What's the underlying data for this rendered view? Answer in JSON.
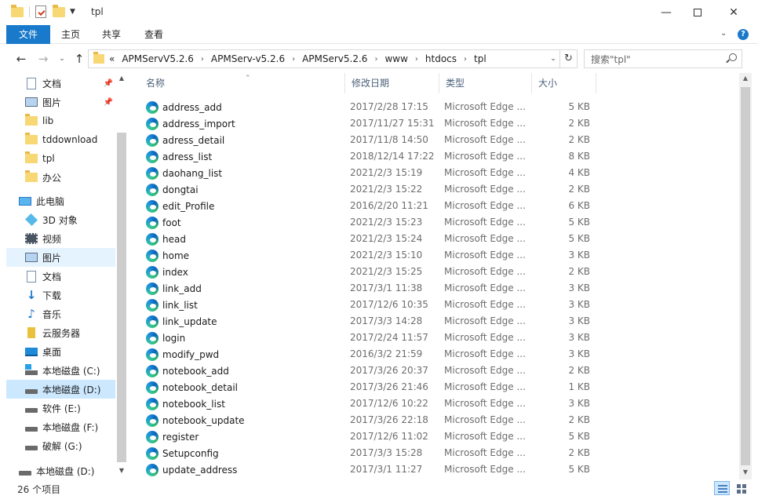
{
  "window": {
    "title": "tpl"
  },
  "ribbon": {
    "tabs": [
      "文件",
      "主页",
      "共享",
      "查看"
    ]
  },
  "address": {
    "overflow": "«",
    "crumbs": [
      "APMServV5.2.6",
      "APMServ-v5.2.6",
      "APMServ5.2.6",
      "www",
      "htdocs",
      "tpl"
    ],
    "separator": "›",
    "search_placeholder": "搜索\"tpl\""
  },
  "nav": {
    "quick": [
      {
        "label": "文档",
        "icon": "document-icon",
        "pinned": true
      },
      {
        "label": "图片",
        "icon": "picture-icon",
        "pinned": true
      },
      {
        "label": "lib",
        "icon": "folder-icon"
      },
      {
        "label": "tddownload",
        "icon": "folder-icon"
      },
      {
        "label": "tpl",
        "icon": "folder-icon"
      },
      {
        "label": "办公",
        "icon": "folder-icon"
      }
    ],
    "pc_label": "此电脑",
    "pc_items": [
      {
        "label": "3D 对象",
        "icon": "3d-objects-icon"
      },
      {
        "label": "视频",
        "icon": "video-icon"
      },
      {
        "label": "图片",
        "icon": "picture-icon",
        "hover": true
      },
      {
        "label": "文档",
        "icon": "document-icon"
      },
      {
        "label": "下载",
        "icon": "download-icon"
      },
      {
        "label": "音乐",
        "icon": "music-icon"
      },
      {
        "label": "云服务器",
        "icon": "cloud-server-icon"
      },
      {
        "label": "桌面",
        "icon": "desktop-icon"
      },
      {
        "label": "本地磁盘 (C:)",
        "icon": "windows-drive-icon"
      },
      {
        "label": "本地磁盘 (D:)",
        "icon": "drive-icon",
        "selected": true
      },
      {
        "label": "软件 (E:)",
        "icon": "drive-icon"
      },
      {
        "label": "本地磁盘 (F:)",
        "icon": "drive-icon"
      },
      {
        "label": "破解 (G:)",
        "icon": "drive-icon"
      }
    ],
    "bottom_label": "本地磁盘 (D:)"
  },
  "columns": {
    "name": "名称",
    "date": "修改日期",
    "type": "类型",
    "size": "大小"
  },
  "files": [
    {
      "name": "address_add",
      "date": "2017/2/28 17:15",
      "type": "Microsoft Edge ...",
      "size": "5 KB"
    },
    {
      "name": "address_import",
      "date": "2017/11/27 15:31",
      "type": "Microsoft Edge ...",
      "size": "2 KB"
    },
    {
      "name": "adress_detail",
      "date": "2017/11/8 14:50",
      "type": "Microsoft Edge ...",
      "size": "2 KB"
    },
    {
      "name": "adress_list",
      "date": "2018/12/14 17:22",
      "type": "Microsoft Edge ...",
      "size": "8 KB"
    },
    {
      "name": "daohang_list",
      "date": "2021/2/3 15:19",
      "type": "Microsoft Edge ...",
      "size": "4 KB"
    },
    {
      "name": "dongtai",
      "date": "2021/2/3 15:22",
      "type": "Microsoft Edge ...",
      "size": "2 KB"
    },
    {
      "name": "edit_Profile",
      "date": "2016/2/20 11:21",
      "type": "Microsoft Edge ...",
      "size": "6 KB"
    },
    {
      "name": "foot",
      "date": "2021/2/3 15:23",
      "type": "Microsoft Edge ...",
      "size": "5 KB"
    },
    {
      "name": "head",
      "date": "2021/2/3 15:24",
      "type": "Microsoft Edge ...",
      "size": "5 KB"
    },
    {
      "name": "home",
      "date": "2021/2/3 15:10",
      "type": "Microsoft Edge ...",
      "size": "3 KB"
    },
    {
      "name": "index",
      "date": "2021/2/3 15:25",
      "type": "Microsoft Edge ...",
      "size": "2 KB"
    },
    {
      "name": "link_add",
      "date": "2017/3/1 11:38",
      "type": "Microsoft Edge ...",
      "size": "3 KB"
    },
    {
      "name": "link_list",
      "date": "2017/12/6 10:35",
      "type": "Microsoft Edge ...",
      "size": "3 KB"
    },
    {
      "name": "link_update",
      "date": "2017/3/3 14:28",
      "type": "Microsoft Edge ...",
      "size": "3 KB"
    },
    {
      "name": "login",
      "date": "2017/2/24 11:57",
      "type": "Microsoft Edge ...",
      "size": "3 KB"
    },
    {
      "name": "modify_pwd",
      "date": "2016/3/2 21:59",
      "type": "Microsoft Edge ...",
      "size": "3 KB"
    },
    {
      "name": "notebook_add",
      "date": "2017/3/26 20:37",
      "type": "Microsoft Edge ...",
      "size": "2 KB"
    },
    {
      "name": "notebook_detail",
      "date": "2017/3/26 21:46",
      "type": "Microsoft Edge ...",
      "size": "1 KB"
    },
    {
      "name": "notebook_list",
      "date": "2017/12/6 10:22",
      "type": "Microsoft Edge ...",
      "size": "3 KB"
    },
    {
      "name": "notebook_update",
      "date": "2017/3/26 22:18",
      "type": "Microsoft Edge ...",
      "size": "2 KB"
    },
    {
      "name": "register",
      "date": "2017/12/6 11:02",
      "type": "Microsoft Edge ...",
      "size": "5 KB"
    },
    {
      "name": "Setupconfig",
      "date": "2017/3/3 15:28",
      "type": "Microsoft Edge ...",
      "size": "2 KB"
    },
    {
      "name": "update_address",
      "date": "2017/3/1 11:27",
      "type": "Microsoft Edge ...",
      "size": "5 KB"
    }
  ],
  "status": {
    "item_count": "26 个项目"
  },
  "colors": {
    "accent": "#1979ca",
    "selection": "#cce8ff",
    "hover": "#e5f3ff"
  }
}
